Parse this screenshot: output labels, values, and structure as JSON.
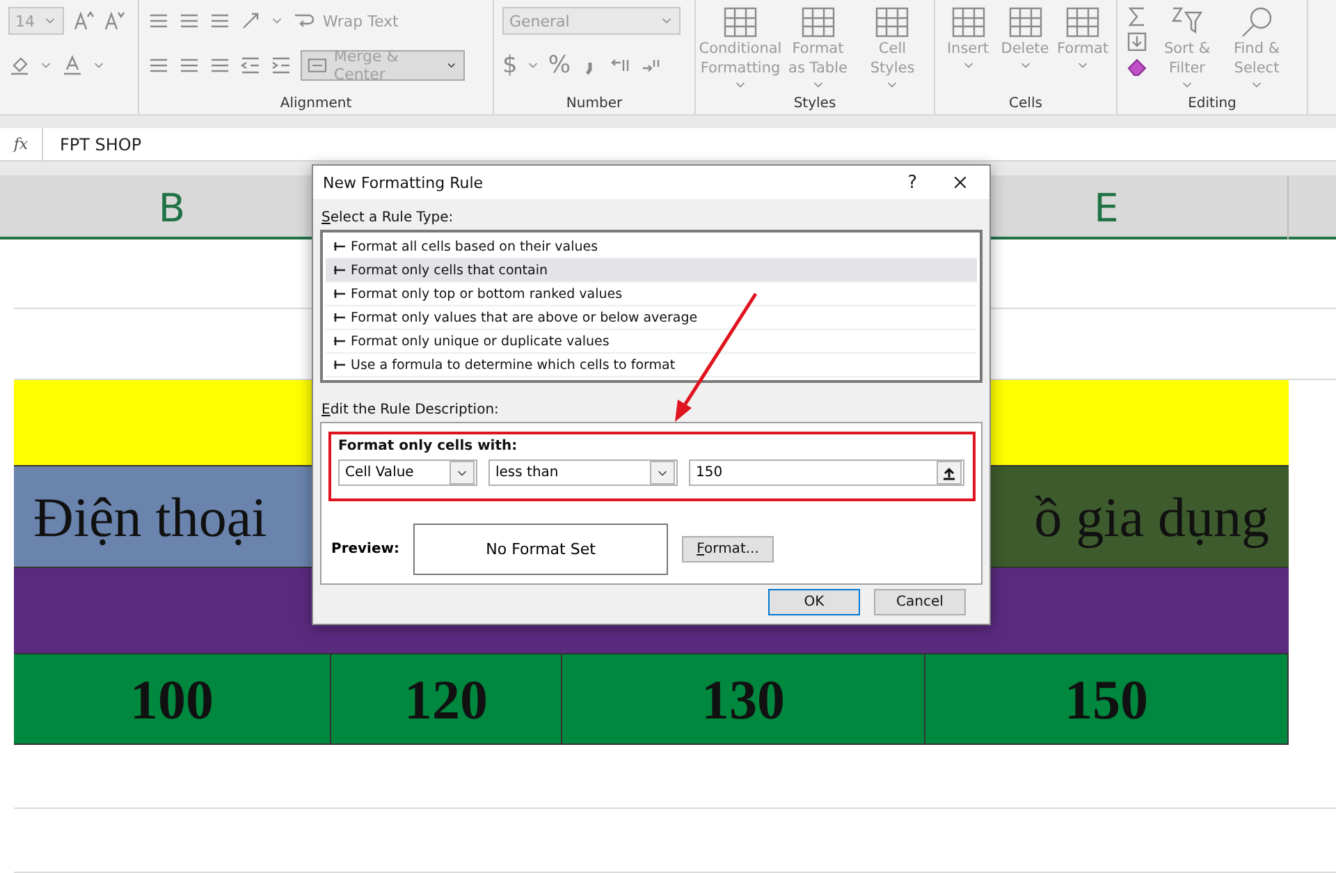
{
  "ribbon": {
    "font_size": "14",
    "wrap_text": "Wrap Text",
    "merge_center": "Merge & Center",
    "number_format": "General",
    "currency": "$",
    "percent": "%",
    "styles": [
      "Conditional Formatting",
      "Format as Table",
      "Cell Styles"
    ],
    "cells": [
      "Insert",
      "Delete",
      "Format"
    ],
    "editing": [
      "Sort & Filter",
      "Find & Select"
    ],
    "groups": [
      "Alignment",
      "Number",
      "Styles",
      "Cells",
      "Editing"
    ]
  },
  "formula_bar": {
    "function_label": "fx",
    "content": "FPT SHOP"
  },
  "column_headers": [
    "B",
    "E"
  ],
  "rows": [
    {
      "kind": "blank"
    },
    {
      "kind": "blank"
    },
    {
      "kind": "band",
      "color": "#ffff00"
    },
    {
      "kind": "category",
      "cells": [
        {
          "text": "Điện thoại",
          "color": "#6a84ae"
        },
        {
          "text": "ồ gia dụng",
          "color": "#3d5b2c"
        }
      ]
    },
    {
      "kind": "band",
      "color": "#5a2a7f"
    },
    {
      "kind": "values",
      "color": "#00883e",
      "cells": [
        "100",
        "120",
        "130",
        "150"
      ]
    },
    {
      "kind": "blank"
    },
    {
      "kind": "blank"
    }
  ],
  "dialog": {
    "title": "New Formatting Rule",
    "help": "?",
    "rule_type_label": "Select a Rule Type:",
    "rule_types": [
      {
        "label": "Format all cells based on their values",
        "selected": false
      },
      {
        "label": "Format only cells that contain",
        "selected": true
      },
      {
        "label": "Format only top or bottom ranked values",
        "selected": false
      },
      {
        "label": "Format only values that are above or below average",
        "selected": false
      },
      {
        "label": "Format only unique or duplicate values",
        "selected": false
      },
      {
        "label": "Use a formula to determine which cells to format",
        "selected": false
      }
    ],
    "description_label": "Edit the Rule Description:",
    "condition_heading": "Format only cells with:",
    "field": "Cell Value",
    "operator": "less than",
    "value": "150",
    "preview_label": "Preview:",
    "preview_text": "No Format Set",
    "format_button": "Format...",
    "buttons": [
      {
        "label": "OK",
        "default": true
      },
      {
        "label": "Cancel",
        "default": false
      }
    ]
  }
}
